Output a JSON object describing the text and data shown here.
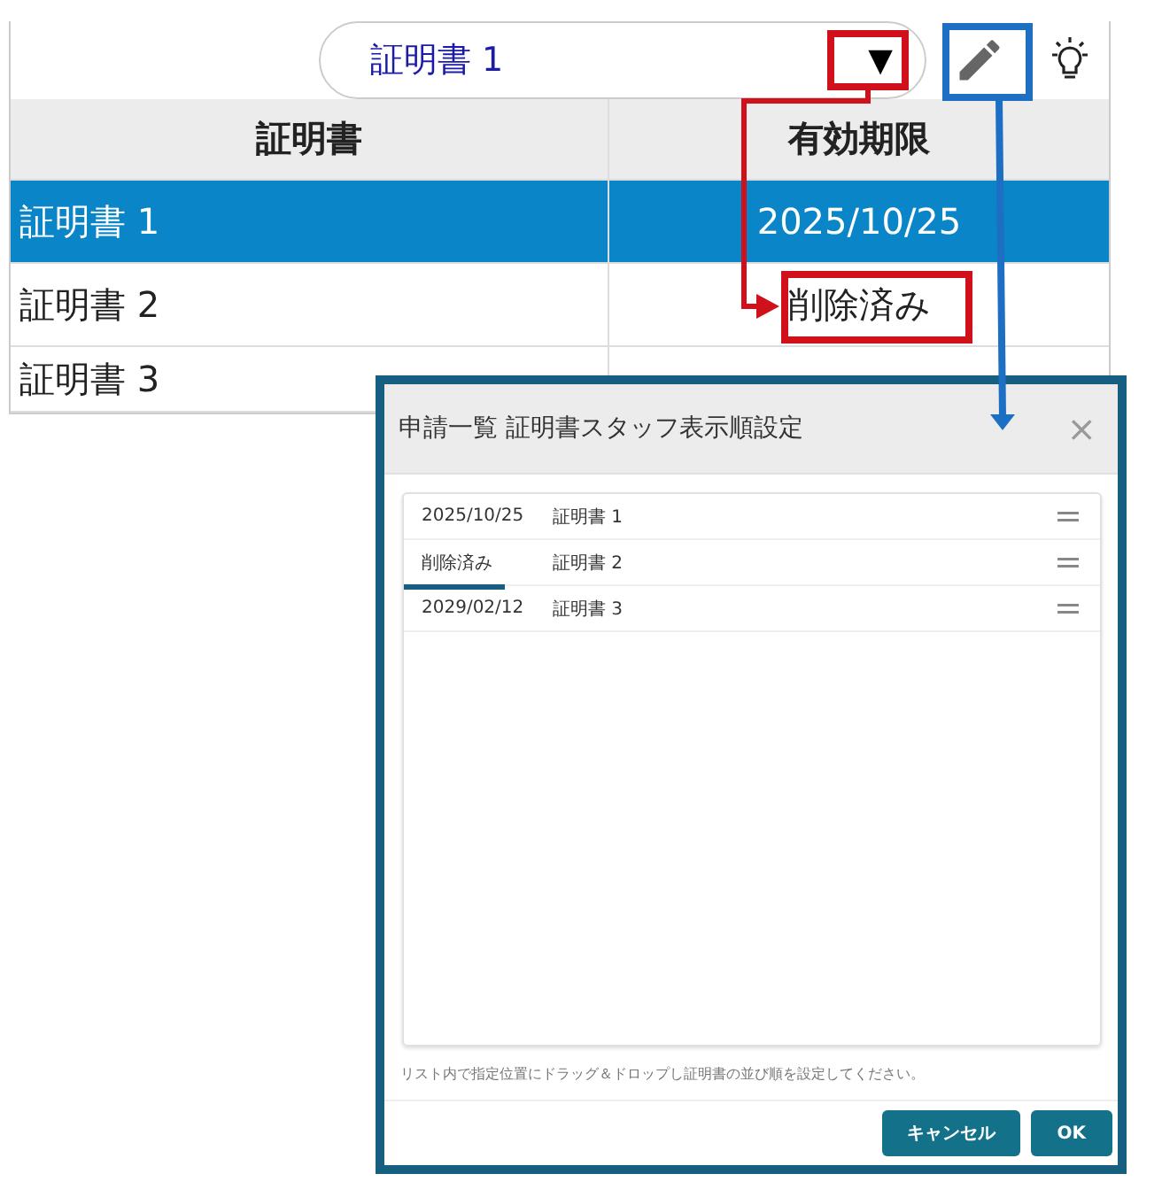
{
  "toolbar": {
    "selector": {
      "value": "証明書 1",
      "caret": "▼"
    }
  },
  "table": {
    "columns": [
      "証明書",
      "有効期限"
    ],
    "rows": [
      {
        "cells": [
          "証明書 1",
          "2025/10/25"
        ],
        "selected": true
      },
      {
        "cells": [
          "証明書 2",
          "削除済み"
        ],
        "selected": false
      },
      {
        "cells": [
          "証明書 3"
        ],
        "selected": false
      }
    ]
  },
  "dialog": {
    "title": "申請一覧 証明書スタッフ表示順設定",
    "close": "×",
    "items": [
      {
        "date": "2025/10/25",
        "name": "証明書 1",
        "underlined": false
      },
      {
        "date": "削除済み",
        "name": "証明書 2",
        "underlined": true
      },
      {
        "date": "2029/02/12",
        "name": "証明書 3",
        "underlined": false
      }
    ],
    "hint": "リスト内で指定位置にドラッグ＆ドロップし証明書の並び順を設定してください。",
    "buttons": [
      "キャンセル",
      "OK"
    ]
  }
}
